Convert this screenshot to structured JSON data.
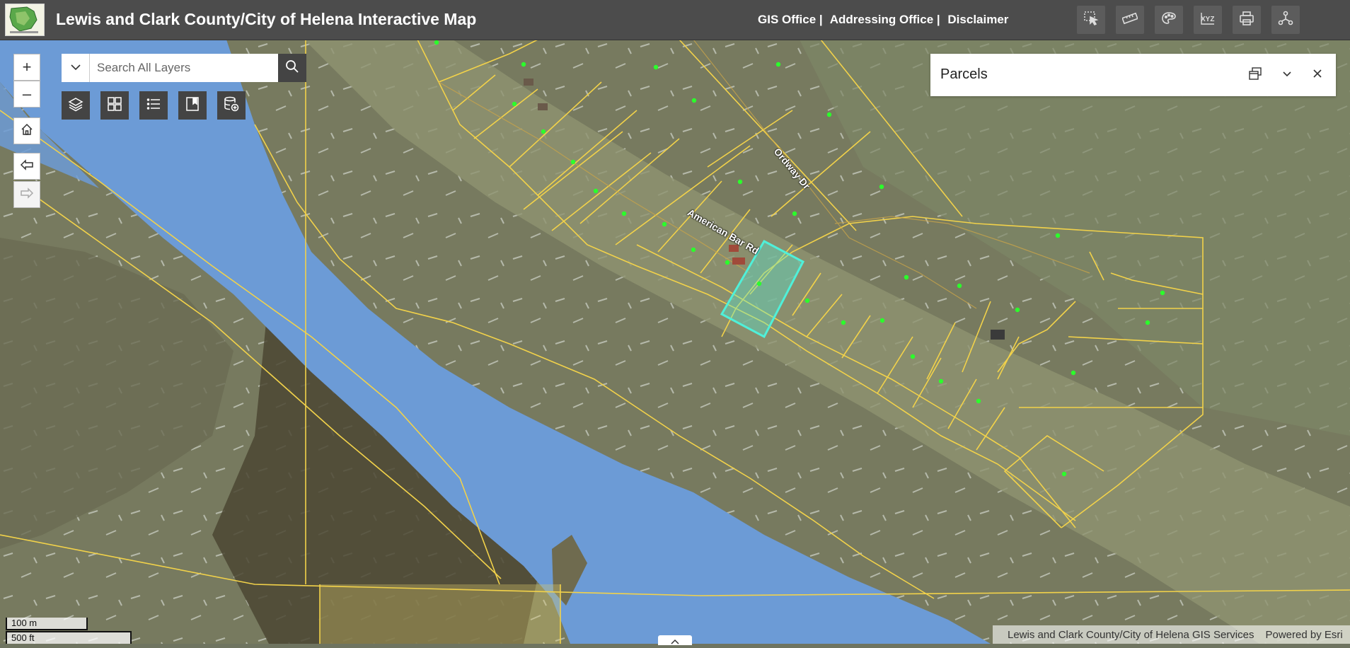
{
  "header": {
    "title": "Lewis and Clark County/City of Helena Interactive Map",
    "links": [
      "GIS Office |",
      "Addressing Office |",
      "Disclaimer"
    ],
    "tools": [
      "select-icon",
      "measure-icon",
      "basemap-icon",
      "coordinates-icon",
      "print-icon",
      "share-icon"
    ]
  },
  "search": {
    "placeholder": "Search All Layers"
  },
  "zoom": {
    "in_label": "+",
    "out_label": "–"
  },
  "panel": {
    "title": "Parcels"
  },
  "map": {
    "road_labels": [
      "American Bar Rd",
      "Ordway Dr"
    ]
  },
  "scale": {
    "metric": "100 m",
    "imperial": "500 ft"
  },
  "attribution": {
    "source": "Lewis and Clark County/City of Helena GIS Services",
    "powered": "Powered by Esri"
  },
  "colors": {
    "header_bg": "#4c4c4c",
    "water": "#6c9bd6",
    "parcel_line": "#f2d24a",
    "selected_parcel": "#4ff0d9",
    "point": "#2bff2b"
  }
}
